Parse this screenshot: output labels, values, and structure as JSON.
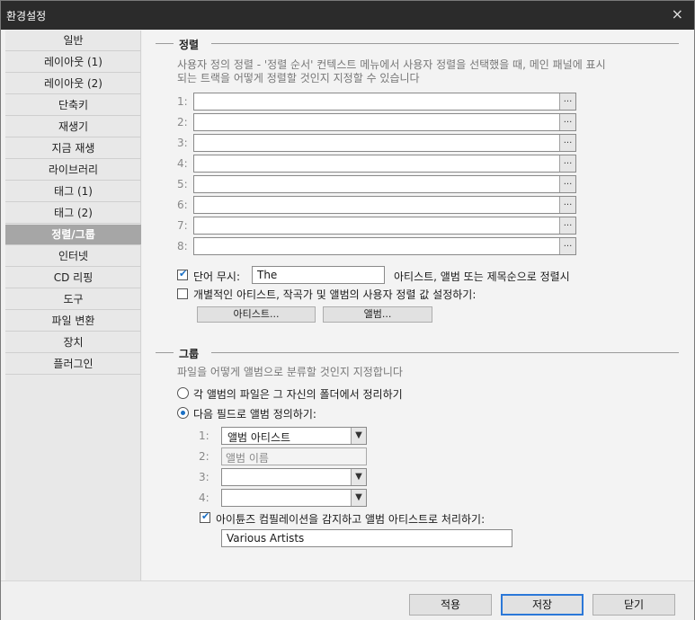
{
  "window": {
    "title": "환경설정",
    "close_icon": "×"
  },
  "sidebar": {
    "items": [
      {
        "label": "일반",
        "selected": false
      },
      {
        "label": "레이아웃 (1)",
        "selected": false
      },
      {
        "label": "레이아웃 (2)",
        "selected": false
      },
      {
        "label": "단축키",
        "selected": false
      },
      {
        "label": "재생기",
        "selected": false
      },
      {
        "label": "지금 재생",
        "selected": false
      },
      {
        "label": "라이브러리",
        "selected": false
      },
      {
        "label": "태그 (1)",
        "selected": false
      },
      {
        "label": "태그 (2)",
        "selected": false
      },
      {
        "label": "정렬/그룹",
        "selected": true
      },
      {
        "label": "인터넷",
        "selected": false
      },
      {
        "label": "CD 리핑",
        "selected": false
      },
      {
        "label": "도구",
        "selected": false
      },
      {
        "label": "파일 변환",
        "selected": false
      },
      {
        "label": "장치",
        "selected": false
      },
      {
        "label": "플러그인",
        "selected": false
      }
    ]
  },
  "sort_section": {
    "title": "정렬",
    "description_line1": "사용자 정의 정렬 - '정렬 순서' 컨텍스트 메뉴에서 사용자 정렬을 선택했을 때, 메인 패널에 표시",
    "description_line2": "되는 트랙을 어떻게 정렬할 것인지 지정할 수 있습니다",
    "rows": [
      {
        "num": "1:",
        "value": "",
        "button": "..."
      },
      {
        "num": "2:",
        "value": "",
        "button": "..."
      },
      {
        "num": "3:",
        "value": "",
        "button": "..."
      },
      {
        "num": "4:",
        "value": "",
        "button": "..."
      },
      {
        "num": "5:",
        "value": "",
        "button": "..."
      },
      {
        "num": "6:",
        "value": "",
        "button": "..."
      },
      {
        "num": "7:",
        "value": "",
        "button": "..."
      },
      {
        "num": "8:",
        "value": "",
        "button": "..."
      }
    ],
    "ignore_words": {
      "checked": true,
      "label": "단어 무시:",
      "value": "The",
      "suffix": "아티스트, 앨범 또는 제목순으로 정렬시"
    },
    "custom_sort_values": {
      "checked": false,
      "label": "개별적인 아티스트, 작곡가 및 앨범의 사용자 정렬 값 설정하기:"
    },
    "artist_button": "아티스트...",
    "album_button": "앨범..."
  },
  "group_section": {
    "title": "그룹",
    "description": "파일을 어떻게 앨범으로 분류할 것인지 지정합니다",
    "option_folder": {
      "selected": false,
      "label": "각 앨범의 파일은 그 자신의 폴더에서 정리하기"
    },
    "option_fields": {
      "selected": true,
      "label": "다음 필드로 앨범 정의하기:"
    },
    "fields": [
      {
        "num": "1:",
        "value": "앨범 아티스트",
        "kind": "combo"
      },
      {
        "num": "2:",
        "value": "앨범 이름",
        "kind": "fixed"
      },
      {
        "num": "3:",
        "value": "",
        "kind": "combo"
      },
      {
        "num": "4:",
        "value": "",
        "kind": "combo"
      }
    ],
    "itunes": {
      "checked": true,
      "label": "아이튠즈 컴필레이션을 감지하고 앨범 아티스트로 처리하기:",
      "value": "Various Artists"
    }
  },
  "footer": {
    "apply": "적용",
    "save": "저장",
    "close": "닫기"
  },
  "colors": {
    "titlebar": "#2b2b2b",
    "selected_item": "#a6a6a6",
    "accent": "#2b78d8",
    "check": "#1a6fc4"
  }
}
